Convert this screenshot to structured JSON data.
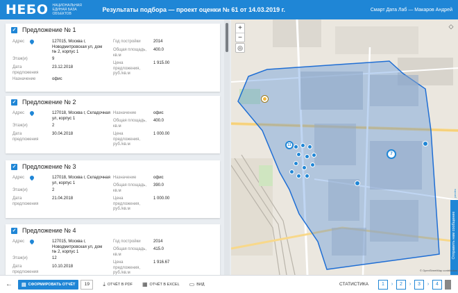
{
  "header": {
    "logo": "НЕБО",
    "logo_sub": "Национальная единая база объектов",
    "title": "Результаты подбора — проект оценки № 61 от 14.03.2019 г.",
    "user": "Смарт Дата Лаб — Макаров Андрей"
  },
  "cards": [
    {
      "title": "Предложение № 1",
      "address_label": "Адрес",
      "address": "127015, Москва г, Новодмитровская ул, дом № 2, корпус 1",
      "floor_label": "Этаж(и)",
      "floor": "9",
      "date_label": "Дата предложения",
      "date": "23.12.2018",
      "purpose_label": "Назначение",
      "purpose": "офис",
      "right": [
        {
          "label": "Год постройки",
          "value": "2014"
        },
        {
          "label": "Общая площадь, кв.м",
          "value": "400.0"
        },
        {
          "label": "Цена предложения, руб./кв.м",
          "value": "1 915.00"
        }
      ]
    },
    {
      "title": "Предложение № 2",
      "address_label": "Адрес",
      "address": "127018, Москва г, Складочная ул, корпус 1",
      "floor_label": "Этаж(и)",
      "floor": "2",
      "date_label": "Дата предложения",
      "date": "30.04.2018",
      "right": [
        {
          "label": "Назначение",
          "value": "офис"
        },
        {
          "label": "Общая площадь, кв.м",
          "value": "400.0"
        },
        {
          "label": "Цена предложения, руб./кв.м",
          "value": "1 000.00"
        }
      ]
    },
    {
      "title": "Предложение № 3",
      "address_label": "Адрес",
      "address": "127018, Москва г, Складочная ул, корпус 1",
      "floor_label": "Этаж(и)",
      "floor": "2",
      "date_label": "Дата предложения",
      "date": "21.04.2018",
      "right": [
        {
          "label": "Назначение",
          "value": "офис"
        },
        {
          "label": "Общая площадь, кв.м",
          "value": "390.0"
        },
        {
          "label": "Цена предложения, руб./кв.м",
          "value": "1 000.00"
        }
      ]
    },
    {
      "title": "Предложение № 4",
      "address_label": "Адрес",
      "address": "127015, Москва г, Новодмитровская ул, дом № 2, корпус 1",
      "floor_label": "Этаж(и)",
      "floor": "12",
      "date_label": "Дата предложения",
      "date": "10.10.2018",
      "right": [
        {
          "label": "Год постройки",
          "value": "2014"
        },
        {
          "label": "Общая площадь, кв.м",
          "value": "415.0"
        },
        {
          "label": "Цена предложения, руб./кв.м",
          "value": "1 916.67"
        }
      ]
    }
  ],
  "map": {
    "zoom_in": "+",
    "zoom_out": "−",
    "cluster_left": "11",
    "cluster_right": "7",
    "feedback": "Отправить нам сообщение",
    "yandex": "yandex",
    "attribution": "© OpenStreetMap contributors"
  },
  "toolbar": {
    "form_report": "СФОРМИРОВАТЬ ОТЧЁТ",
    "count": "19",
    "pdf": "ОТЧЁТ В PDF",
    "excel": "ОТЧЁТ В EXCEL",
    "view": "ВИД",
    "stats": "СТАТИСТИКА",
    "steps": [
      "1",
      "2",
      "3",
      "4"
    ]
  },
  "colors": {
    "accent": "#1f86d6",
    "area": "#3b7ed9"
  }
}
